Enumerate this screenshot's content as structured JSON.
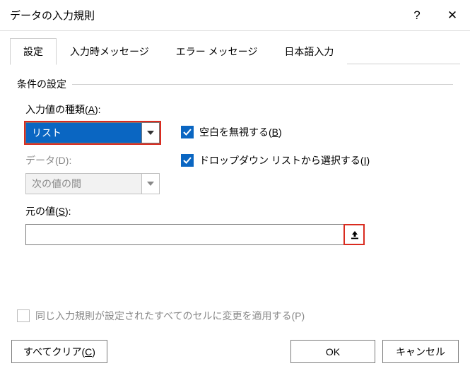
{
  "window": {
    "title": "データの入力規則",
    "help_symbol": "?",
    "close_symbol": "✕"
  },
  "tabs": {
    "settings": "設定",
    "input_message": "入力時メッセージ",
    "error_message": "エラー メッセージ",
    "ime": "日本語入力"
  },
  "fieldset_label": "条件の設定",
  "allow": {
    "label_prefix": "入力値の種類(",
    "label_key": "A",
    "label_suffix": "):",
    "value": "リスト"
  },
  "data": {
    "label_prefix": "データ(",
    "label_key": "D",
    "label_suffix": "):",
    "value": "次の値の間"
  },
  "ignore_blank": {
    "checked": true,
    "label_prefix": "空白を無視する(",
    "label_key": "B",
    "label_suffix": ")"
  },
  "dropdown": {
    "checked": true,
    "label_prefix": "ドロップダウン リストから選択する(",
    "label_key": "I",
    "label_suffix": ")"
  },
  "source": {
    "label_prefix": "元の値(",
    "label_key": "S",
    "label_suffix": "):",
    "value": ""
  },
  "apply_all": {
    "checked": false,
    "label_prefix": "同じ入力規則が設定されたすべてのセルに変更を適用する(",
    "label_key": "P",
    "label_suffix": ")"
  },
  "footer": {
    "clear_prefix": "すべてクリア(",
    "clear_key": "C",
    "clear_suffix": ")",
    "ok": "OK",
    "cancel": "キャンセル"
  }
}
